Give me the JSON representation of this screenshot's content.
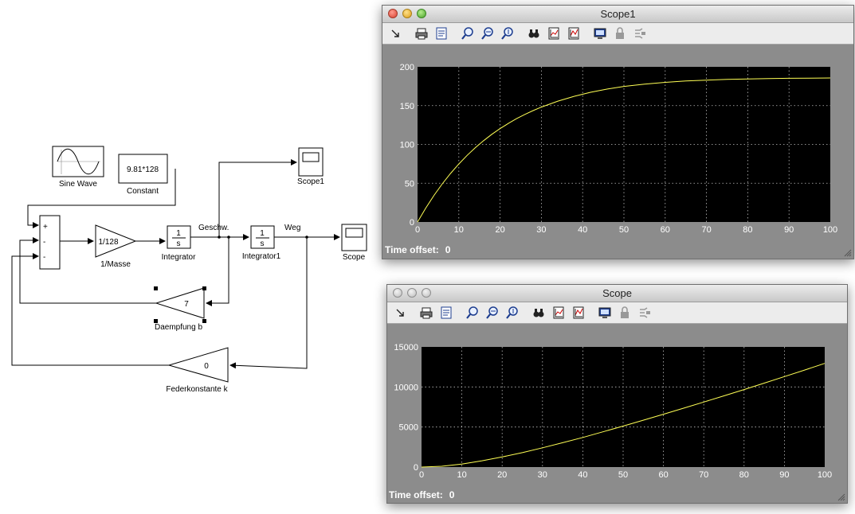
{
  "diagram": {
    "sine_label": "Sine Wave",
    "constant_value": "9.81*128",
    "constant_label": "Constant",
    "sum_signs": [
      "+",
      "-",
      "-"
    ],
    "gain_value": "1/128",
    "gain_label": "1/Masse",
    "integrator_num": "1",
    "integrator_den": "s",
    "integrator_label": "Integrator",
    "integrator1_num": "1",
    "integrator1_den": "s",
    "integrator1_label": "Integrator1",
    "signal_geschw": "Geschw.",
    "signal_weg": "Weg",
    "scope1_label": "Scope1",
    "scope_label": "Scope",
    "damping_value": "7",
    "damping_label": "Daempfung b",
    "spring_value": "0",
    "spring_label": "Federkonstante k"
  },
  "windows": [
    {
      "title": "Scope1",
      "offset_label": "Time offset:",
      "offset_value": "0"
    },
    {
      "title": "Scope",
      "offset_label": "Time offset:",
      "offset_value": "0"
    }
  ],
  "toolbar_icons": [
    "pointer-icon",
    "print-icon",
    "params-icon",
    "zoom-icon",
    "zoom-x-icon",
    "zoom-y-icon",
    "autoscale-icon",
    "save-axes-icon",
    "restore-axes-icon",
    "floating-scope-icon",
    "lock-icon",
    "signal-select-icon"
  ],
  "colors": {
    "plot_bg": "#000000",
    "grid": "#bfbfbf",
    "trace": "#ffff55",
    "window_bg": "#8c8c8c"
  },
  "chart_data": [
    {
      "type": "line",
      "title": "",
      "xlim": [
        0,
        100
      ],
      "ylim": [
        0,
        200
      ],
      "xticks": [
        0,
        10,
        20,
        30,
        40,
        50,
        60,
        70,
        80,
        90,
        100
      ],
      "yticks": [
        0,
        50,
        100,
        150,
        200
      ],
      "grid": true,
      "series": [
        {
          "x": [
            0,
            2,
            4,
            6,
            8,
            10,
            12,
            14,
            16,
            18,
            20,
            22,
            24,
            26,
            28,
            30,
            34,
            38,
            42,
            46,
            50,
            55,
            60,
            65,
            70,
            75,
            80,
            85,
            90,
            95,
            100
          ],
          "y": [
            0,
            18.1,
            34.4,
            49.2,
            62.6,
            74.8,
            85.8,
            95.8,
            104.8,
            113,
            120.4,
            127.1,
            133.2,
            138.7,
            143.6,
            148.1,
            155.8,
            162.1,
            167.3,
            171.4,
            174.8,
            177.7,
            180,
            181.7,
            182.9,
            183.8,
            184.4,
            184.9,
            185.2,
            185.4,
            185.6
          ]
        }
      ]
    },
    {
      "type": "line",
      "title": "",
      "xlim": [
        0,
        100
      ],
      "ylim": [
        0,
        15000
      ],
      "xticks": [
        0,
        10,
        20,
        30,
        40,
        50,
        60,
        70,
        80,
        90,
        100
      ],
      "yticks": [
        0,
        5000,
        10000,
        15000
      ],
      "grid": true,
      "series": [
        {
          "x": [
            0,
            5,
            10,
            15,
            20,
            25,
            30,
            35,
            40,
            45,
            50,
            55,
            60,
            65,
            70,
            75,
            80,
            85,
            90,
            95,
            100
          ],
          "y": [
            0,
            100,
            380,
            780,
            1260,
            1800,
            2400,
            3040,
            3700,
            4400,
            5120,
            5850,
            6600,
            7350,
            8120,
            8890,
            9680,
            10480,
            11290,
            12110,
            12940
          ]
        }
      ]
    }
  ]
}
